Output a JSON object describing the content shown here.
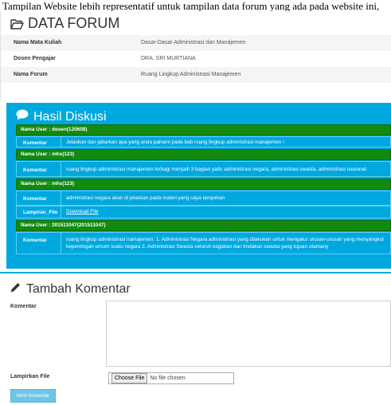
{
  "caption": "Tampilan Website lebih representatif untuk tampilan data forum yang ada pada website ini, sehingga pengguna",
  "forum": {
    "title": "DATA FORUM",
    "rows": [
      {
        "label": "Nama Mata Kuliah",
        "value": "Dasar-Dasar Administrasi dan Manajemen"
      },
      {
        "label": "Dosen Pengajar",
        "value": "DRA. SRI MURTIANA"
      },
      {
        "label": "Nama Forum",
        "value": "Ruang Lingkup Administrasi Manajemen"
      }
    ]
  },
  "hasil": {
    "title": "Hasil Diskusi",
    "entries": [
      {
        "user": "Nama User : dosen(120608)",
        "komentar_label": "Komentar",
        "komentar": "Jelaskan dan jabarkan apa yang anda pahami pada bab ruang lingkup administrasi manajemen !"
      },
      {
        "user": "Nama User : mhs(123)",
        "komentar_label": "Komentar",
        "komentar": "ruang lingkup administrasi manajemen terbagi menjadi 3 bagian yaitu administrasi negara, administrasi swasta, administrasi nasional."
      },
      {
        "user": "Nama User : mhs(123)",
        "komentar_label": "Komentar",
        "komentar": "administrasi negara akan di jelaskan pada materi yang saya lampirkan",
        "lampiran_label": "Lampiran_File",
        "lampiran_link": "Download File"
      },
      {
        "user": "Nama User : 201511047(201511047)",
        "komentar_label": "Komentar",
        "komentar": "ruang lingkup administrasi namajemen: 1. Administrasi Negara administrasi yang dilakukan untuk mengatur urusan-urusan yang menyangkut kepentingan umum suatu negara 2. Administrasi Swasta seluruh kegiatan dan tindakan swasta yang tujuan utamany"
      }
    ]
  },
  "tambah": {
    "title": "Tambah Komentar",
    "komentar_label": "Komentar",
    "lampiran_label": "Lampirkan File",
    "choose_file": "Choose File",
    "no_file": "No file chosen",
    "submit": "Kirim Komentar"
  },
  "colors": {
    "accent": "#00a8e0",
    "user_row": "#128a10",
    "submit": "#6fc5e6"
  }
}
